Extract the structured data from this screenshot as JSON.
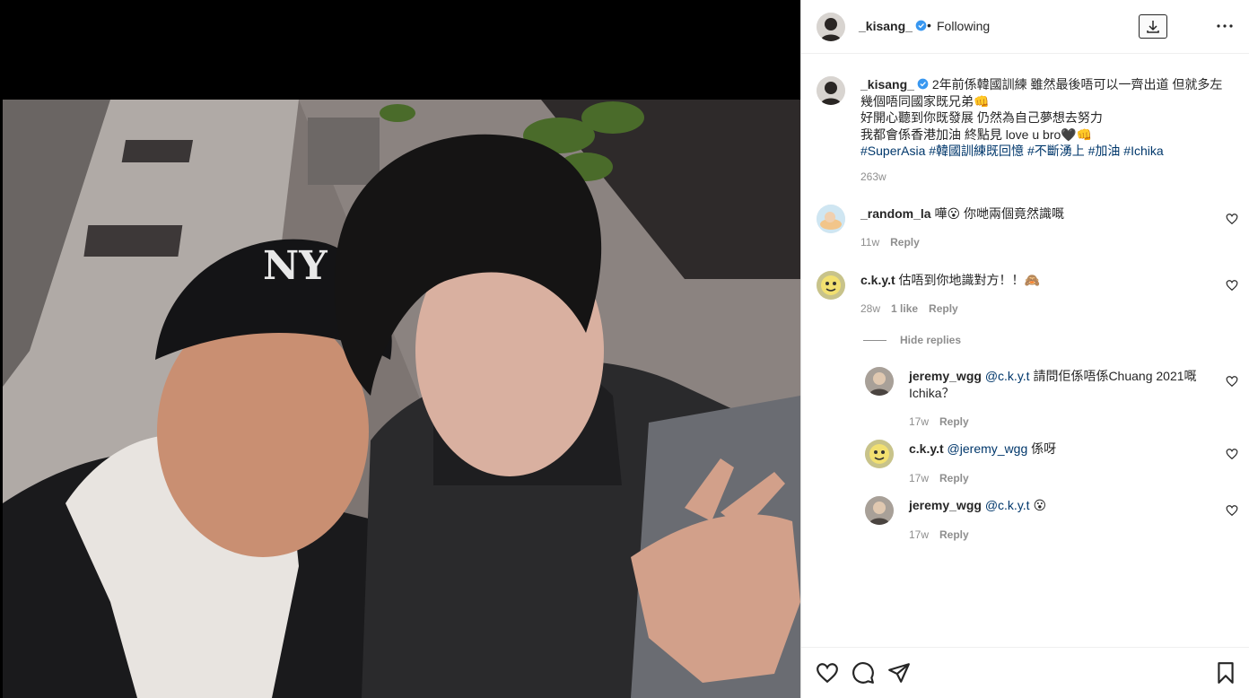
{
  "post": {
    "username": "_kisang_",
    "follow_status": "Following",
    "separator": "•",
    "caption_username": "_kisang_",
    "caption_lines": [
      "2年前係韓國訓練 雖然最後唔可以一齊出道 但就多左幾個唔同國家既兄弟👊",
      "好開心聽到你既發展 仍然為自己夢想去努力",
      "我都會係香港加油 終點見 love u bro🖤👊"
    ],
    "hashtags": "#SuperAsia #韓國訓練既回憶 #不斷湧上 #加油 #Ichika",
    "time": "263w"
  },
  "comments": [
    {
      "username": "_random_la",
      "text": "嘩😮 你哋兩個竟然識嘅",
      "time": "11w",
      "likes": "",
      "reply_label": "Reply"
    },
    {
      "username": "c.k.y.t",
      "text": "估唔到你地識對方！！🙈",
      "time": "28w",
      "likes": "1 like",
      "reply_label": "Reply"
    }
  ],
  "hide_replies_label": "Hide replies",
  "replies": [
    {
      "username": "jeremy_wgg",
      "mention": "@c.k.y.t",
      "text": " 請問佢係唔係Chuang 2021嘅Ichika？",
      "time": "17w",
      "reply_label": "Reply"
    },
    {
      "username": "c.k.y.t",
      "mention": "@jeremy_wgg",
      "text": " 係呀",
      "time": "17w",
      "reply_label": "Reply"
    },
    {
      "username": "jeremy_wgg",
      "mention": "@c.k.y.t",
      "text": " 😮",
      "time": "17w",
      "reply_label": "Reply"
    }
  ],
  "icons": {
    "verified": "verified-badge-icon",
    "download": "download-icon",
    "more": "more-options-icon",
    "like": "heart-icon",
    "comment": "comment-icon",
    "share": "share-icon",
    "save": "bookmark-icon"
  },
  "colors": {
    "link": "#00376b",
    "verified": "#3897f0",
    "muted": "#8e8e8e",
    "text": "#262626"
  }
}
